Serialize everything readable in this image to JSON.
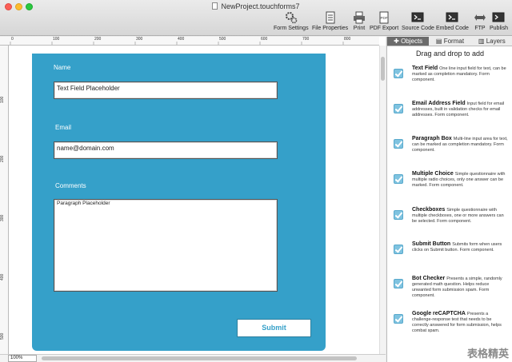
{
  "window": {
    "title": "NewProject.touchforms7"
  },
  "toolbar": {
    "items": [
      {
        "label": "Form Settings",
        "icon": "gears-icon"
      },
      {
        "label": "File Properties",
        "icon": "file-properties-icon"
      },
      {
        "label": "Print",
        "icon": "printer-icon"
      },
      {
        "label": "PDF Export",
        "icon": "pdf-icon"
      },
      {
        "label": "Source Code",
        "icon": "terminal-icon"
      },
      {
        "label": "Embed Code",
        "icon": "embed-icon"
      },
      {
        "label": "FTP",
        "icon": "ftp-icon"
      },
      {
        "label": "Publish",
        "icon": "publish-icon"
      }
    ]
  },
  "ruler": {
    "top_marks": [
      "0",
      "100",
      "200",
      "300",
      "400",
      "500",
      "600",
      "700",
      "800"
    ],
    "left_marks": [
      "100",
      "200",
      "300",
      "400",
      "500"
    ]
  },
  "form": {
    "background_color": "#35a0c9",
    "name_label": "Name",
    "name_value": "Text Field Placeholder",
    "email_label": "Email",
    "email_value": "name@domain.com",
    "comments_label": "Comments",
    "comments_value": "Paragraph Placeholder",
    "submit_label": "Submit"
  },
  "statusbar": {
    "zoom": "100%"
  },
  "panel": {
    "tabs": [
      {
        "label": "Objects",
        "active": true
      },
      {
        "label": "Format",
        "active": false
      },
      {
        "label": "Layers",
        "active": false
      }
    ],
    "heading": "Drag and drop to add",
    "components": [
      {
        "name": "Text Field",
        "desc": "One line input field for text, can be marked as completion mandatory.  Form component."
      },
      {
        "name": "Email Address Field",
        "desc": "Input field for email addresses, built in validation checks for email addresses.  Form component."
      },
      {
        "name": "Paragraph Box",
        "desc": "Multi-line input area for text, can be marked as completion mandatory.  Form component."
      },
      {
        "name": "Multiple Choice",
        "desc": "Simple questionnaire with multiple radio choices, only one answer can be marked.  Form component."
      },
      {
        "name": "Checkboxes",
        "desc": "Simple questionnaire with multiple checkboxes, one or more answers can be selected.  Form component."
      },
      {
        "name": "Submit Button",
        "desc": "Submits form when users clicks on Submit button.  Form component."
      },
      {
        "name": "Bot Checker",
        "desc": "Presents a simple, randomly generated math question.  Helps reduce unwanted form submission spam.  Form component."
      },
      {
        "name": "Google reCAPTCHA",
        "desc": "Presents a challenge-response test that needs to be correctly answered for form submission, helps combat spam."
      }
    ],
    "watermark": "表格精英"
  }
}
